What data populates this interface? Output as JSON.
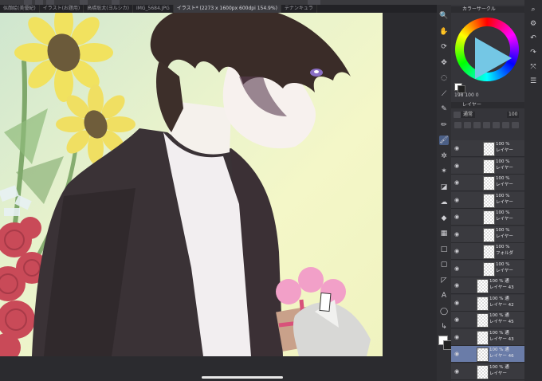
{
  "tabs": [
    {
      "label": "似顔絵(美優紀)"
    },
    {
      "label": "イラスト(お題用)"
    },
    {
      "label": "高橋聡太(ヨルシカ)"
    },
    {
      "label": "IMG_5684.JPG"
    },
    {
      "label": "イラスト* (2273 x 1600px 600dpi 154.9%)"
    },
    {
      "label": "テナンキュラ"
    }
  ],
  "active_tab_index": 4,
  "color_panel": {
    "title": "カラーサークル",
    "readout": "198 100 0",
    "wheel_color": "#2aa9d8"
  },
  "layer_panel": {
    "title": "レイヤー",
    "blend_mode": "通常",
    "opacity": "100"
  },
  "layers": [
    {
      "line1": "100 %",
      "line2": "レイヤー"
    },
    {
      "line1": "100 %",
      "line2": "レイヤー"
    },
    {
      "line1": "100 %",
      "line2": "レイヤー"
    },
    {
      "line1": "100 %",
      "line2": "レイヤー"
    },
    {
      "line1": "100 %",
      "line2": "レイヤー"
    },
    {
      "line1": "100 %",
      "line2": "レイヤー"
    },
    {
      "line1": "100 %",
      "line2": "フォルダ"
    },
    {
      "line1": "100 %",
      "line2": "レイヤー"
    },
    {
      "line1": "100 % 通",
      "line2": "レイヤー 43"
    },
    {
      "line1": "100 % 通",
      "line2": "レイヤー 42"
    },
    {
      "line1": "100 % 通",
      "line2": "レイヤー 45"
    },
    {
      "line1": "100 % 通",
      "line2": "レイヤー 43"
    },
    {
      "line1": "100 % 通",
      "line2": "レイヤー 46"
    },
    {
      "line1": "100 % 通",
      "line2": "レイヤー"
    }
  ],
  "selected_layer_index": 12,
  "tools": [
    {
      "icon": "zoom-icon",
      "glyph": "🔍"
    },
    {
      "icon": "hand-icon",
      "glyph": "✋"
    },
    {
      "icon": "rotate-icon",
      "glyph": "⟳"
    },
    {
      "icon": "move-icon",
      "glyph": "✥"
    },
    {
      "icon": "lasso-icon",
      "glyph": "◌"
    },
    {
      "icon": "eyedropper-icon",
      "glyph": "⟋"
    },
    {
      "icon": "pen-icon",
      "glyph": "✎"
    },
    {
      "icon": "pencil-icon",
      "glyph": "✏"
    },
    {
      "icon": "brush-icon",
      "glyph": "🖌"
    },
    {
      "icon": "airbrush-icon",
      "glyph": "✲"
    },
    {
      "icon": "decoration-icon",
      "glyph": "✶"
    },
    {
      "icon": "eraser-icon",
      "glyph": "◪"
    },
    {
      "icon": "blend-icon",
      "glyph": "☁"
    },
    {
      "icon": "fill-icon",
      "glyph": "◆"
    },
    {
      "icon": "gradient-icon",
      "glyph": "▦"
    },
    {
      "icon": "figure-icon",
      "glyph": "□"
    },
    {
      "icon": "frame-icon",
      "glyph": "▢"
    },
    {
      "icon": "ruler-icon",
      "glyph": "◸"
    },
    {
      "icon": "text-icon",
      "glyph": "A"
    },
    {
      "icon": "balloon-icon",
      "glyph": "◯"
    },
    {
      "icon": "correct-line-icon",
      "glyph": "↳"
    }
  ],
  "active_tool_index": 8,
  "right_strip": [
    {
      "icon": "search-icon",
      "glyph": "⌕"
    },
    {
      "icon": "settings-icon",
      "glyph": "⚙"
    },
    {
      "icon": "undo-icon",
      "glyph": "↶"
    },
    {
      "icon": "redo-icon",
      "glyph": "↷"
    },
    {
      "icon": "transform-icon",
      "glyph": "⤧"
    },
    {
      "icon": "layer-settings-icon",
      "glyph": "☰"
    }
  ]
}
